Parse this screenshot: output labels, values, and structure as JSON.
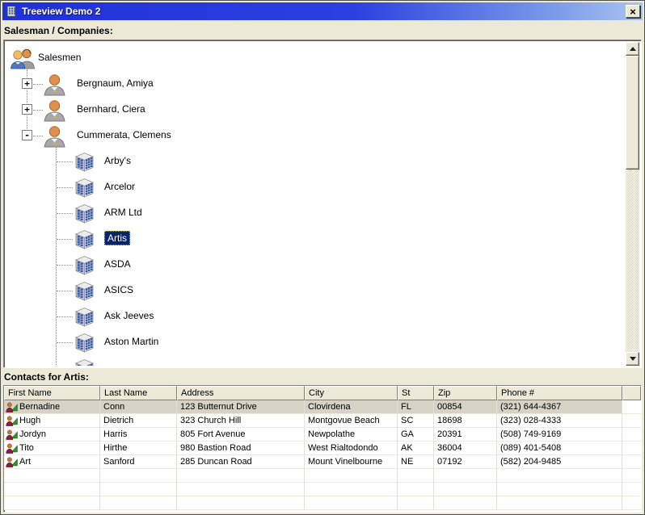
{
  "window": {
    "title": "Treeview Demo 2",
    "close_glyph": "×"
  },
  "tree_label": "Salesman / Companies:",
  "contacts_label": "Contacts for Artis:",
  "tree": {
    "root": "Salesmen",
    "salesmen": [
      {
        "name": "Bergnaum, Amiya",
        "toggle": "+",
        "expanded": false
      },
      {
        "name": "Bernhard, Ciera",
        "toggle": "+",
        "expanded": false
      },
      {
        "name": "Cummerata, Clemens",
        "toggle": "-",
        "expanded": true
      }
    ],
    "companies": [
      "Arby's",
      "Arcelor",
      "ARM Ltd",
      "Artis",
      "ASDA",
      "ASICS",
      "Ask Jeeves",
      "Aston Martin"
    ],
    "selected_company": "Artis",
    "selected_company_index": 3
  },
  "table": {
    "columns": [
      "First Name",
      "Last Name",
      "Address",
      "City",
      "St",
      "Zip",
      "Phone #"
    ],
    "rows": [
      [
        "Bernadine",
        "Conn",
        "123 Butternut Drive",
        "Clovirdena",
        "FL",
        "00854",
        "(321) 644-4367"
      ],
      [
        "Hugh",
        "Dietrich",
        "323 Church Hill",
        "Montgovue Beach",
        "SC",
        "18698",
        "(323) 028-4333"
      ],
      [
        "Jordyn",
        "Harris",
        "805 Fort Avenue",
        "Newpolathe",
        "GA",
        "20391",
        "(508) 749-9169"
      ],
      [
        "Tito",
        "Hirthe",
        "980 Bastion Road",
        "West Rialtodondo",
        "AK",
        "36004",
        "(089) 401-5408"
      ],
      [
        "Art",
        "Sanford",
        "285 Duncan Road",
        "Mount Vinelbourne",
        "NE",
        "07192",
        "(582) 204-9485"
      ]
    ],
    "selected_row_index": 0,
    "empty_row_count": 3
  },
  "icons": {
    "app": "building-grid-icon",
    "tree_root": "salesmen-group-icon",
    "salesman": "salesman-person-icon",
    "company": "office-building-icon",
    "contact": "contact-person-icon",
    "close": "close-x-icon",
    "scroll_up": "scroll-up-arrow-icon",
    "scroll_down": "scroll-down-arrow-icon"
  },
  "colors": {
    "window_bg": "#ece9d8",
    "titlebar_left": "#2130d8",
    "titlebar_right": "#a9c3f0",
    "selection_navy": "#0a246a",
    "selected_row_bg": "#d6d2c6",
    "panel_bg": "#ffffff"
  }
}
